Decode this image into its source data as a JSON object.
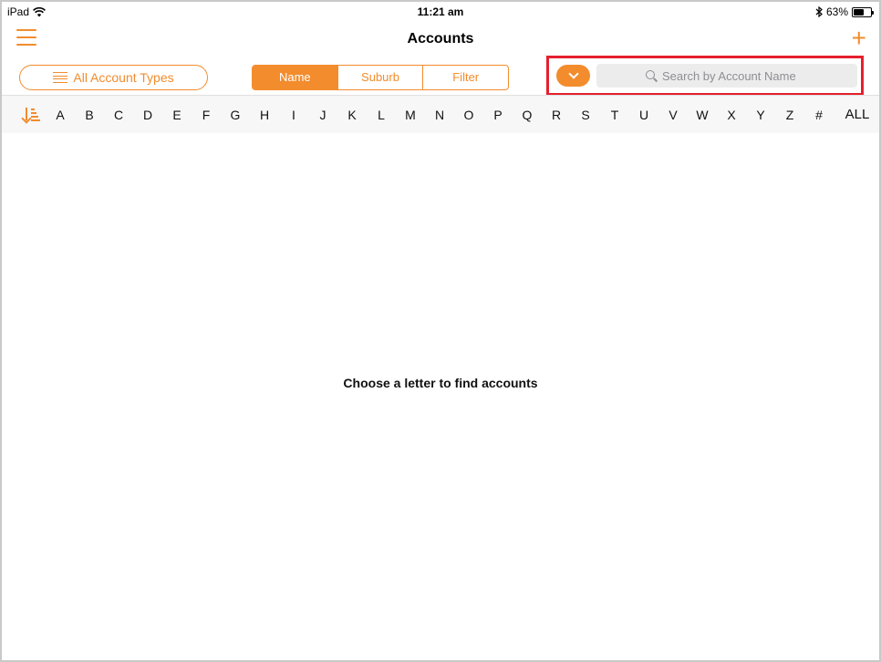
{
  "status_bar": {
    "device": "iPad",
    "time": "11:21 am",
    "battery": "63%",
    "battery_level": 0.63
  },
  "nav": {
    "title": "Accounts",
    "add_label": "+"
  },
  "toolbar": {
    "account_types_label": "All Account Types",
    "segments": [
      "Name",
      "Suburb",
      "Filter"
    ],
    "selected_segment": "Name",
    "search_placeholder": "Search by Account Name"
  },
  "alpha_bar": {
    "letters": [
      "A",
      "B",
      "C",
      "D",
      "E",
      "F",
      "G",
      "H",
      "I",
      "J",
      "K",
      "L",
      "M",
      "N",
      "O",
      "P",
      "Q",
      "R",
      "S",
      "T",
      "U",
      "V",
      "W",
      "X",
      "Y",
      "Z",
      "#"
    ],
    "all_label": "ALL"
  },
  "content": {
    "empty_message": "Choose a letter to find accounts"
  },
  "colors": {
    "accent": "#f28c2d",
    "highlight": "#e5202e"
  }
}
